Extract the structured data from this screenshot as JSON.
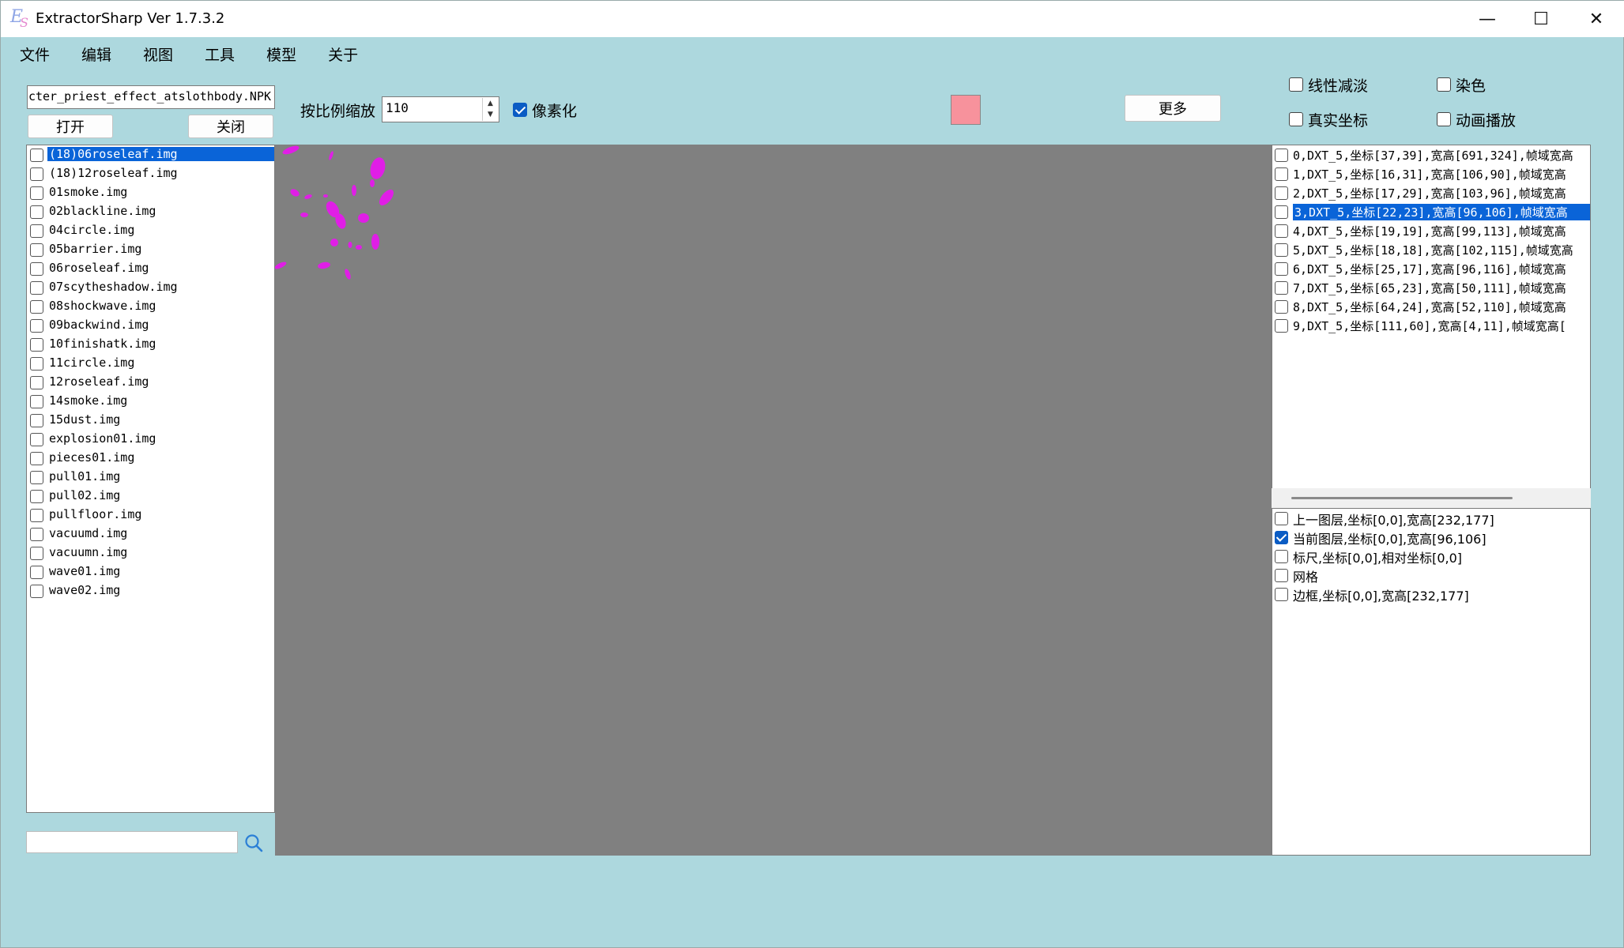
{
  "window": {
    "title": "ExtractorSharp Ver 1.7.3.2",
    "minimize": "—",
    "maximize": "☐",
    "close": "✕"
  },
  "menu": [
    "文件",
    "编辑",
    "视图",
    "工具",
    "模型",
    "关于"
  ],
  "toolbar": {
    "file_path": "cter_priest_effect_atslothbody.NPK",
    "open_label": "打开",
    "close_label": "关闭",
    "scale_label": "按比例缩放",
    "scale_value": "110",
    "pixelate_label": "像素化",
    "pixelate_checked": true,
    "swatch_color": "#f7929c",
    "more_label": "更多",
    "linear_fade_label": "线性减淡",
    "dye_label": "染色",
    "real_coord_label": "真实坐标",
    "animation_label": "动画播放"
  },
  "files": [
    "(18)06roseleaf.img",
    "(18)12roseleaf.img",
    "01smoke.img",
    "02blackline.img",
    "04circle.img",
    "05barrier.img",
    "06roseleaf.img",
    "07scytheshadow.img",
    "08shockwave.img",
    "09backwind.img",
    "10finishatk.img",
    "11circle.img",
    "12roseleaf.img",
    "14smoke.img",
    "15dust.img",
    "explosion01.img",
    "pieces01.img",
    "pull01.img",
    "pull02.img",
    "pullfloor.img",
    "vacuumd.img",
    "vacuumn.img",
    "wave01.img",
    "wave02.img"
  ],
  "selected_file_index": 0,
  "frames": [
    "0,DXT_5,坐标[37,39],宽高[691,324],帧域宽高",
    "1,DXT_5,坐标[16,31],宽高[106,90],帧域宽高",
    "2,DXT_5,坐标[17,29],宽高[103,96],帧域宽高",
    "3,DXT_5,坐标[22,23],宽高[96,106],帧域宽高",
    "4,DXT_5,坐标[19,19],宽高[99,113],帧域宽高",
    "5,DXT_5,坐标[18,18],宽高[102,115],帧域宽高",
    "6,DXT_5,坐标[25,17],宽高[96,116],帧域宽高",
    "7,DXT_5,坐标[65,23],宽高[50,111],帧域宽高",
    "8,DXT_5,坐标[64,24],宽高[52,110],帧域宽高",
    "9,DXT_5,坐标[111,60],宽高[4,11],帧域宽高["
  ],
  "selected_frame_index": 3,
  "layers": [
    {
      "label": "上一图层,坐标[0,0],宽高[232,177]",
      "checked": false
    },
    {
      "label": "当前图层,坐标[0,0],宽高[96,106]",
      "checked": true
    },
    {
      "label": "标尺,坐标[0,0],相对坐标[0,0]",
      "checked": false
    },
    {
      "label": "网格",
      "checked": false
    },
    {
      "label": "边框,坐标[0,0],宽高[232,177]",
      "checked": false
    }
  ],
  "colors": {
    "background": "#add8de",
    "canvas": "#808080",
    "selection": "#0a64d8",
    "petal": "#e01ee6"
  }
}
